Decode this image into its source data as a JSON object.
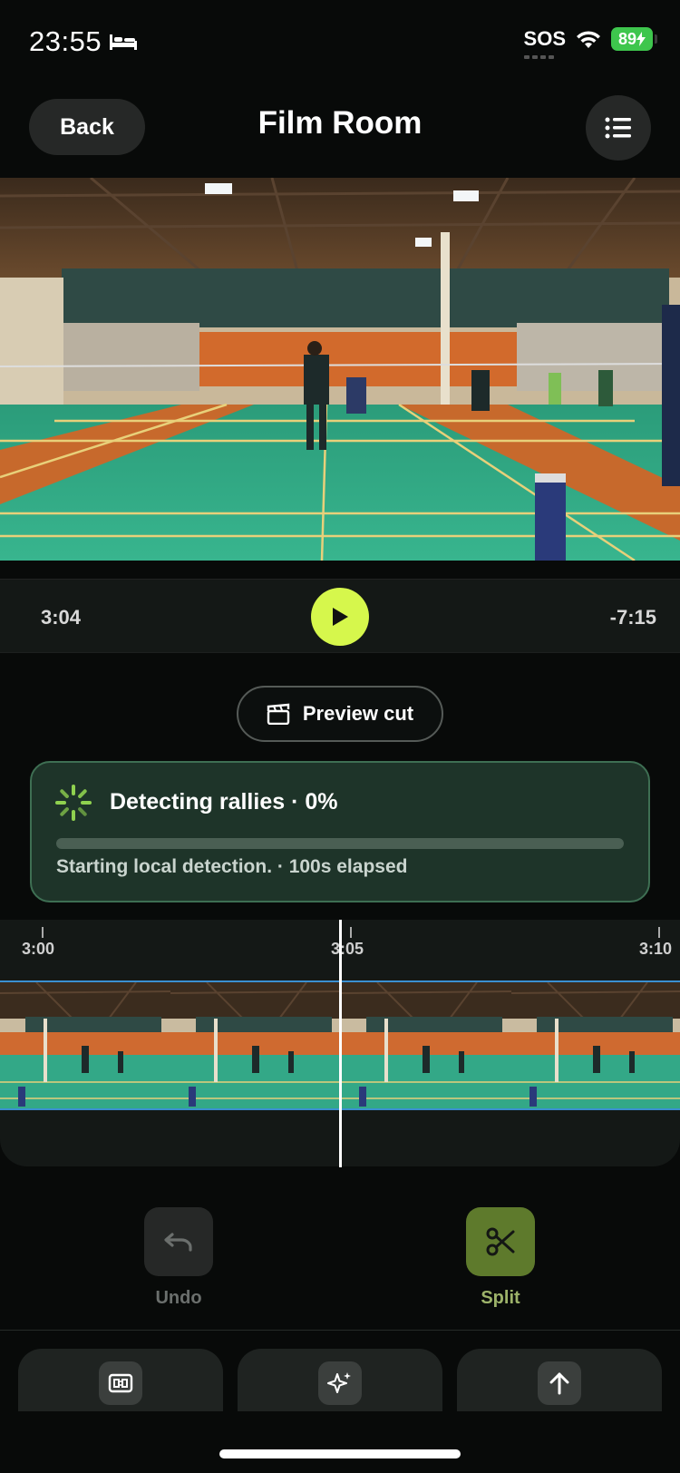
{
  "status_bar": {
    "time": "23:55",
    "sos": "SOS",
    "battery": "89"
  },
  "header": {
    "back_label": "Back",
    "title": "Film Room"
  },
  "player": {
    "current_time": "3:04",
    "remaining_time": "-7:15"
  },
  "preview_cut_label": "Preview cut",
  "detection": {
    "title": "Detecting rallies · 0%",
    "progress": 0,
    "status": "Starting local detection. · 100s elapsed",
    "accent": "#d6f74c"
  },
  "timeline": {
    "ticks": [
      "3:00",
      "3:05",
      "3:10"
    ]
  },
  "tools": {
    "undo_label": "Undo",
    "split_label": "Split"
  },
  "bottom_actions": {
    "scoreboard_icon": "scoreboard-icon",
    "sparkles_icon": "sparkles-icon",
    "upload_icon": "upload-icon"
  }
}
